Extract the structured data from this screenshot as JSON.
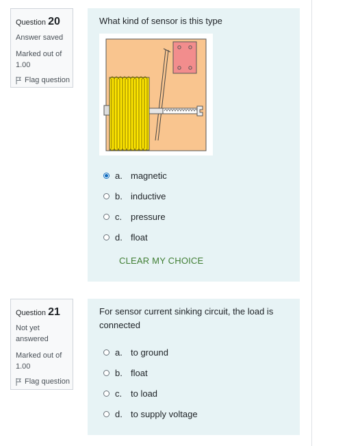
{
  "questions": [
    {
      "number_prefix": "Question",
      "number": "20",
      "state": "Answer saved",
      "grade": "Marked out of 1.00",
      "flag_label": "Flag question",
      "text": "What kind of sensor is this type",
      "options": [
        {
          "letter": "a.",
          "label": "magnetic",
          "selected": true
        },
        {
          "letter": "b.",
          "label": "inductive",
          "selected": false
        },
        {
          "letter": "c.",
          "label": "pressure",
          "selected": false
        },
        {
          "letter": "d.",
          "label": "float",
          "selected": false
        }
      ],
      "clear_label": "CLEAR MY CHOICE"
    },
    {
      "number_prefix": "Question",
      "number": "21",
      "state": "Not yet answered",
      "grade": "Marked out of 1.00",
      "flag_label": "Flag question",
      "text": "For sensor current sinking circuit, the load is connected",
      "options": [
        {
          "letter": "a.",
          "label": "to ground",
          "selected": false
        },
        {
          "letter": "b.",
          "label": "float",
          "selected": false
        },
        {
          "letter": "c.",
          "label": "to load",
          "selected": false
        },
        {
          "letter": "d.",
          "label": "to supply voltage",
          "selected": false
        }
      ]
    }
  ],
  "colors": {
    "accent": "#0f6cbf",
    "clear_link": "#3f7d32",
    "content_bg": "#e7f3f5",
    "info_bg": "#f8f9fa",
    "coil_yellow": "#ffe600",
    "housing": "#f9c58f",
    "red_box": "#f28d8d"
  }
}
